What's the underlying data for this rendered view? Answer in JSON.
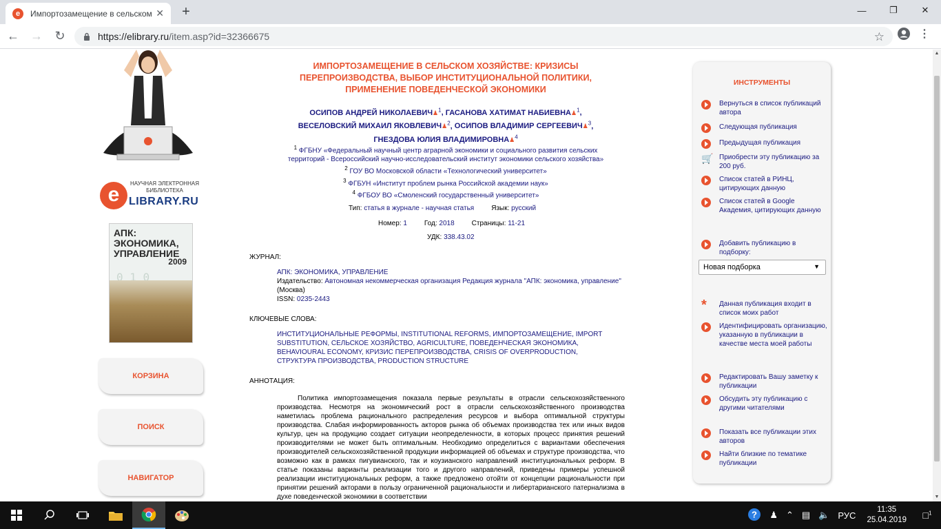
{
  "browser": {
    "tab_title": "Импортозамещение в сельском",
    "url_host": "https://elibrary.ru",
    "url_path": "/item.asp?id=32366675"
  },
  "sidebar": {
    "logo_small": "НАУЧНАЯ ЭЛЕКТРОННАЯ БИБЛИОТЕКА",
    "logo_big": "LIBRARY.RU",
    "logo_letter": "e",
    "cover_title": "АПК: ЭКОНОМИКА, УПРАВЛЕНИЕ",
    "cover_year": "2009",
    "buttons": [
      {
        "label": "КОРЗИНА"
      },
      {
        "label": "ПОИСК"
      },
      {
        "label": "НАВИГАТОР"
      }
    ]
  },
  "article": {
    "title": "ИМПОРТОЗАМЕЩЕНИЕ В СЕЛЬСКОМ ХОЗЯЙСТВЕ: КРИЗИСЫ ПЕРЕПРОИЗВОДСТВА, ВЫБОР ИНСТИТУЦИОНАЛЬНОЙ ПОЛИТИКИ, ПРИМЕНЕНИЕ ПОВЕДЕНЧЕСКОЙ ЭКОНОМИКИ",
    "authors": [
      {
        "name": "ОСИПОВ АНДРЕЙ НИКОЛАЕВИЧ",
        "aff": "1"
      },
      {
        "name": "ГАСАНОВА ХАТИМАТ НАБИЕВНА",
        "aff": "1"
      },
      {
        "name": "ВЕСЕЛОВСКИЙ МИХАИЛ ЯКОВЛЕВИЧ",
        "aff": "2"
      },
      {
        "name": "ОСИПОВ ВЛАДИМИР СЕРГЕЕВИЧ",
        "aff": "3"
      },
      {
        "name": "ГНЕЗДОВА ЮЛИЯ ВЛАДИМИРОВНА",
        "aff": "4"
      }
    ],
    "affiliations": [
      {
        "num": "1",
        "text": "ФГБНУ «Федеральный научный центр аграрной экономики и социального развития сельских территорий - Всероссийский научно-исследовательский институт экономики сельского хозяйства»"
      },
      {
        "num": "2",
        "text": "ГОУ ВО Московской области «Технологический университет»"
      },
      {
        "num": "3",
        "text": "ФГБУН «Институт проблем рынка Российской академии наук»"
      },
      {
        "num": "4",
        "text": "ФГБОУ ВО «Смоленский государственный университет»"
      }
    ],
    "meta": {
      "type_label": "Тип:",
      "type_value": "статья в журнале - научная статья",
      "lang_label": "Язык:",
      "lang_value": "русский",
      "number_label": "Номер:",
      "number_value": "1",
      "year_label": "Год:",
      "year_value": "2018",
      "pages_label": "Страницы:",
      "pages_value": "11-21",
      "udk_label": "УДК:",
      "udk_value": "338.43.02"
    },
    "journal_label": "ЖУРНАЛ:",
    "journal_name": "АПК: ЭКОНОМИКА, УПРАВЛЕНИЕ",
    "publisher_label": "Издательство:",
    "publisher_value": "Автономная некоммерческая организация Редакция журнала \"АПК: экономика, управление\"",
    "publisher_city": "(Москва)",
    "issn_label": "ISSN:",
    "issn_value": "0235-2443",
    "keywords_label": "КЛЮЧЕВЫЕ СЛОВА:",
    "keywords": "ИНСТИТУЦИОНАЛЬНЫЕ РЕФОРМЫ, INSTITUTIONAL REFORMS, ИМПОРТОЗАМЕЩЕНИЕ, IMPORT SUBSTITUTION, СЕЛЬСКОЕ ХОЗЯЙСТВО, AGRICULTURE, ПОВЕДЕНЧЕСКАЯ ЭКОНОМИКА, BEHAVIOURAL ECONOMY, КРИЗИС ПЕРЕПРОИЗВОДСТВА, CRISIS OF OVERPRODUCTION, СТРУКТУРА ПРОИЗВОДСТВА, PRODUCTION STRUCTURE",
    "abstract_label": "АННОТАЦИЯ:",
    "abstract": "Политика импортозамещения показала первые результаты в отрасли сельскохозяйственного производства. Несмотря на экономический рост в отрасли сельскохозяйственного производства наметилась проблема рационального распределения ресурсов и выбора оптимальной структуры производства. Слабая информированность акторов рынка об объемах производства тех или иных видов культур, цен на продукцию создает ситуации неопределенности, в которых процесс принятия решений производителями не может быть оптимальным. Необходимо определиться с вариантами обеспечения производителей сельскохозяйственной продукции информацией об объемах и структуре производства, что возможно как в рамках пигувианского, так и коузианского направлений институциональных реформ. В статье показаны варианты реализации того и другого направлений, приведены примеры успешной реализации институциональных реформ, а также предложено отойти от концепции рациональности при принятии решений акторами в пользу ограниченной рациональности и либертарианского патернализма в духе поведенческой экономики в соответствии"
  },
  "tools": {
    "title": "ИНСТРУМЕНТЫ",
    "items": [
      "Вернуться в список публикаций автора",
      "Следующая публикация",
      "Предыдущая публикация",
      "Приобрести эту публикацию за 200 руб.",
      "Список статей в РИНЦ, цитирующих данную",
      "Список статей в Google Академия, цитирующих данную",
      "Добавить публикацию в подборку:",
      "Данная публикация входит в список моих работ",
      "Идентифицировать организацию, указанную в публикации в качестве места моей работы",
      "Редактировать Вашу заметку к публикации",
      "Обсудить эту публикацию с другими читателями",
      "Показать все публикации этих авторов",
      "Найти близкие по тематике публикации"
    ],
    "select_value": "Новая подборка"
  },
  "taskbar": {
    "lang": "РУС",
    "time": "11:35",
    "date": "25.04.2019",
    "notif_count": "1"
  }
}
